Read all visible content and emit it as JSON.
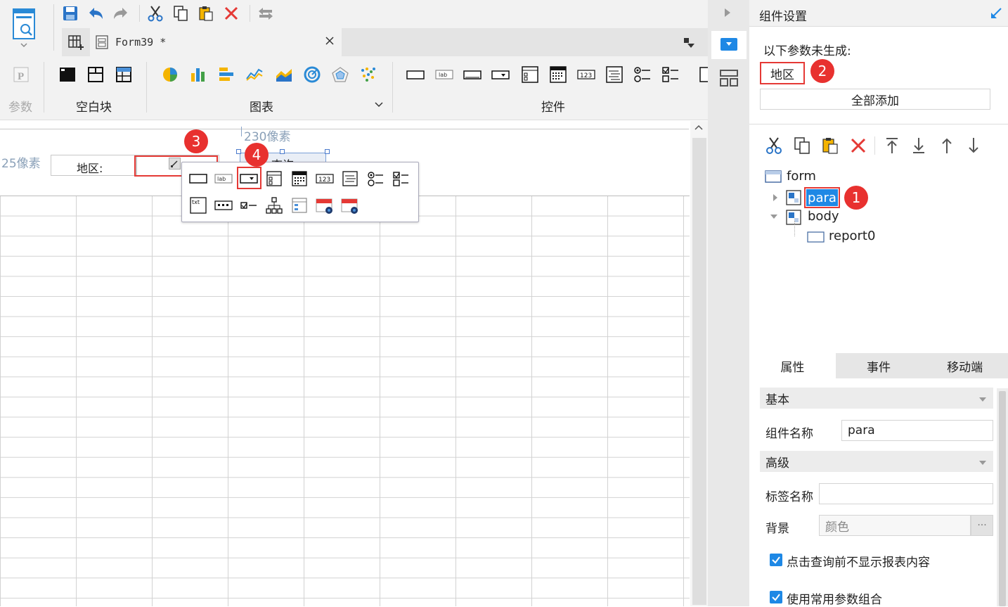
{
  "app": {
    "tab_title": "Form39 *",
    "ribbon": {
      "param_label": "参数",
      "blank_label": "空白块",
      "chart_label": "图表",
      "control_label": "控件"
    }
  },
  "canvas": {
    "width_hint": "230像素",
    "height_hint": "25像素",
    "label_text": "地区:",
    "query_button": "查询"
  },
  "annotations": {
    "b1": "1",
    "b2": "2",
    "b3": "3",
    "b4": "4"
  },
  "panel": {
    "title": "组件设置",
    "ungenerated": "以下参数未生成:",
    "param_chip": "地区",
    "add_all": "全部添加",
    "tree": {
      "form": "form",
      "para": "para",
      "body": "body",
      "report": "report0"
    },
    "tabs": [
      "属性",
      "事件",
      "移动端"
    ],
    "sections": {
      "basic": "基本",
      "advanced": "高级"
    },
    "props": {
      "name_label": "组件名称",
      "name_value": "para",
      "tag_label": "标签名称",
      "tag_value": "",
      "bg_label": "背景",
      "bg_value": "颜色",
      "bg_more": "···",
      "check1": "点击查询前不显示报表内容",
      "check2": "使用常用参数组合"
    }
  },
  "colors": {
    "accent_blue": "#1e88e5",
    "annotation_red": "#e53935"
  }
}
